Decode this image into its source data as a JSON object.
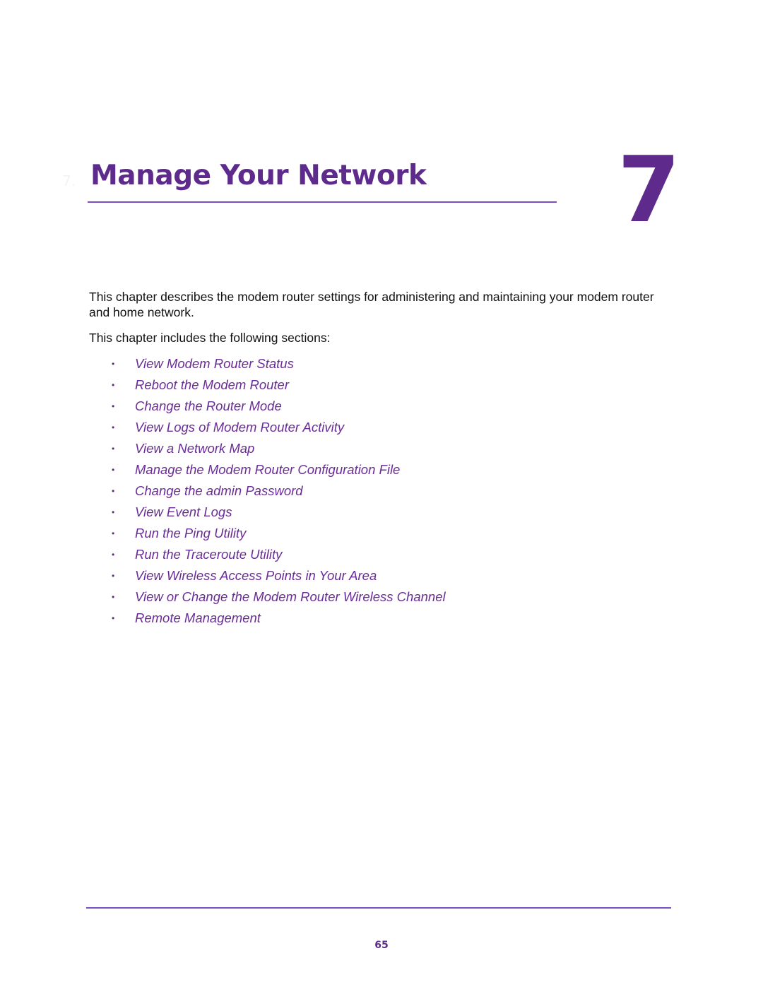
{
  "chapter": {
    "ghost_label": "7.",
    "title": "Manage Your Network",
    "number": "7"
  },
  "intro": {
    "paragraph": "This chapter describes the modem router settings for administering and maintaining your modem router and home network.",
    "lead": "This chapter includes the following sections:"
  },
  "sections": [
    {
      "label": "View Modem Router Status"
    },
    {
      "label": "Reboot the Modem Router"
    },
    {
      "label": "Change the Router Mode"
    },
    {
      "label": "View Logs of Modem Router Activity"
    },
    {
      "label": "View a Network Map"
    },
    {
      "label": "Manage the Modem Router Configuration File"
    },
    {
      "label": "Change the admin Password"
    },
    {
      "label": "View Event Logs"
    },
    {
      "label": "Run the Ping Utility"
    },
    {
      "label": "Run the Traceroute Utility"
    },
    {
      "label": "View Wireless Access Points in Your Area"
    },
    {
      "label": "View or Change the Modem Router Wireless Channel"
    },
    {
      "label": "Remote Management"
    }
  ],
  "bullet_glyph": "•",
  "footer": {
    "page_number": "65"
  },
  "colors": {
    "accent": "#5e2b8c",
    "link": "#6a2c96",
    "rule": "#7a4fc0",
    "body_text": "#111111"
  }
}
